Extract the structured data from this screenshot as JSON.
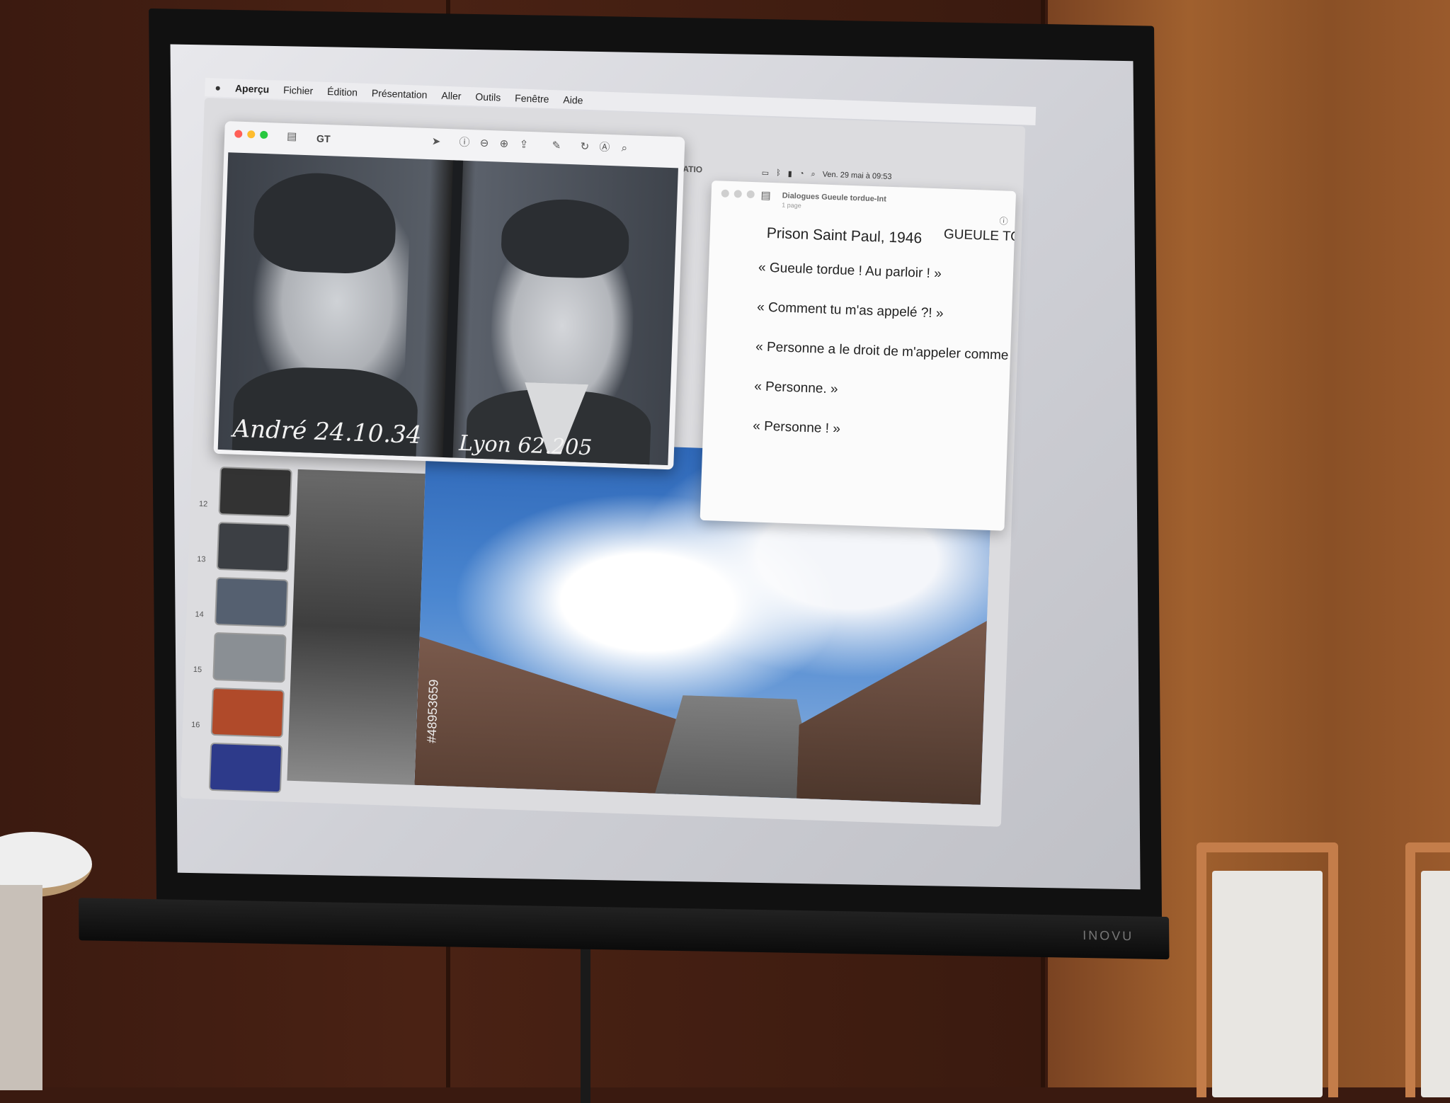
{
  "menubar": {
    "app_name": "Aperçu",
    "items": [
      "Fichier",
      "Édition",
      "Présentation",
      "Aller",
      "Outils",
      "Fenêtre",
      "Aide"
    ]
  },
  "status": {
    "clock": "Ven. 29 mai à 09:53"
  },
  "keynote": {
    "doc_title": "K-PRÉSENTATIO",
    "thumbnail_numbers": [
      "12",
      "13",
      "14",
      "15",
      "16"
    ],
    "stock_watermark": "#48953659"
  },
  "preview_window": {
    "title": "GT",
    "mugshot_caption_left": "André 24.10.34",
    "mugshot_caption_right": "Lyon 62.205"
  },
  "dialogue_window": {
    "title": "Dialogues Gueule tordue-Int",
    "subtitle": "1 page",
    "heading": "Prison Saint Paul, 1946",
    "heading_right": "GUEULE TO",
    "lines": [
      "« Gueule tordue ! Au parloir ! »",
      "« Comment tu m'as appelé ?! »",
      "« Personne a le droit de m'appeler comme ç",
      "« Personne. »",
      "« Personne ! »"
    ]
  },
  "screen": {
    "brand": "INOVU"
  },
  "colors": {
    "traffic_red": "#ff5f57",
    "traffic_yellow": "#febc2e",
    "traffic_green": "#28c840",
    "wood_wall": "#a0602e"
  }
}
